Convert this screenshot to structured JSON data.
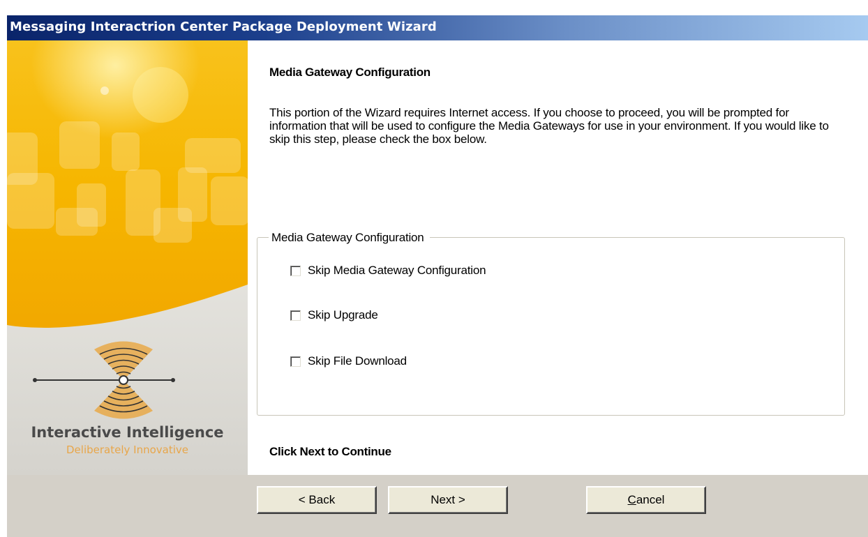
{
  "window": {
    "title": "Messaging Interactrion Center Package Deployment Wizard"
  },
  "banner": {
    "brand_name": "Interactive Intelligence",
    "tagline": "Deliberately Innovative",
    "logo_icon": "interactive-intelligence-logo"
  },
  "page": {
    "heading": "Media Gateway Configuration",
    "description": "This portion of the Wizard requires Internet access.  If you choose to proceed, you will be prompted for information that will be used to configure the Media Gateways for use in your environment.  If you would like to skip this step, please check the box below.",
    "group_label": "Media Gateway Configuration",
    "options": [
      {
        "label": "Skip Media Gateway Configuration",
        "checked": false
      },
      {
        "label": "Skip Upgrade",
        "checked": false
      },
      {
        "label": "Skip File Download",
        "checked": false
      }
    ],
    "footer_hint": "Click Next to Continue"
  },
  "buttons": {
    "back": "< Back",
    "next": "Next >",
    "cancel_mnemonic": "C",
    "cancel_rest": "ancel"
  },
  "colors": {
    "title_bar_start": "#0a246a",
    "title_bar_end": "#a6caf0",
    "banner_accent": "#f5b400",
    "tagline": "#e8a64a",
    "button_face": "#ece9d8"
  }
}
